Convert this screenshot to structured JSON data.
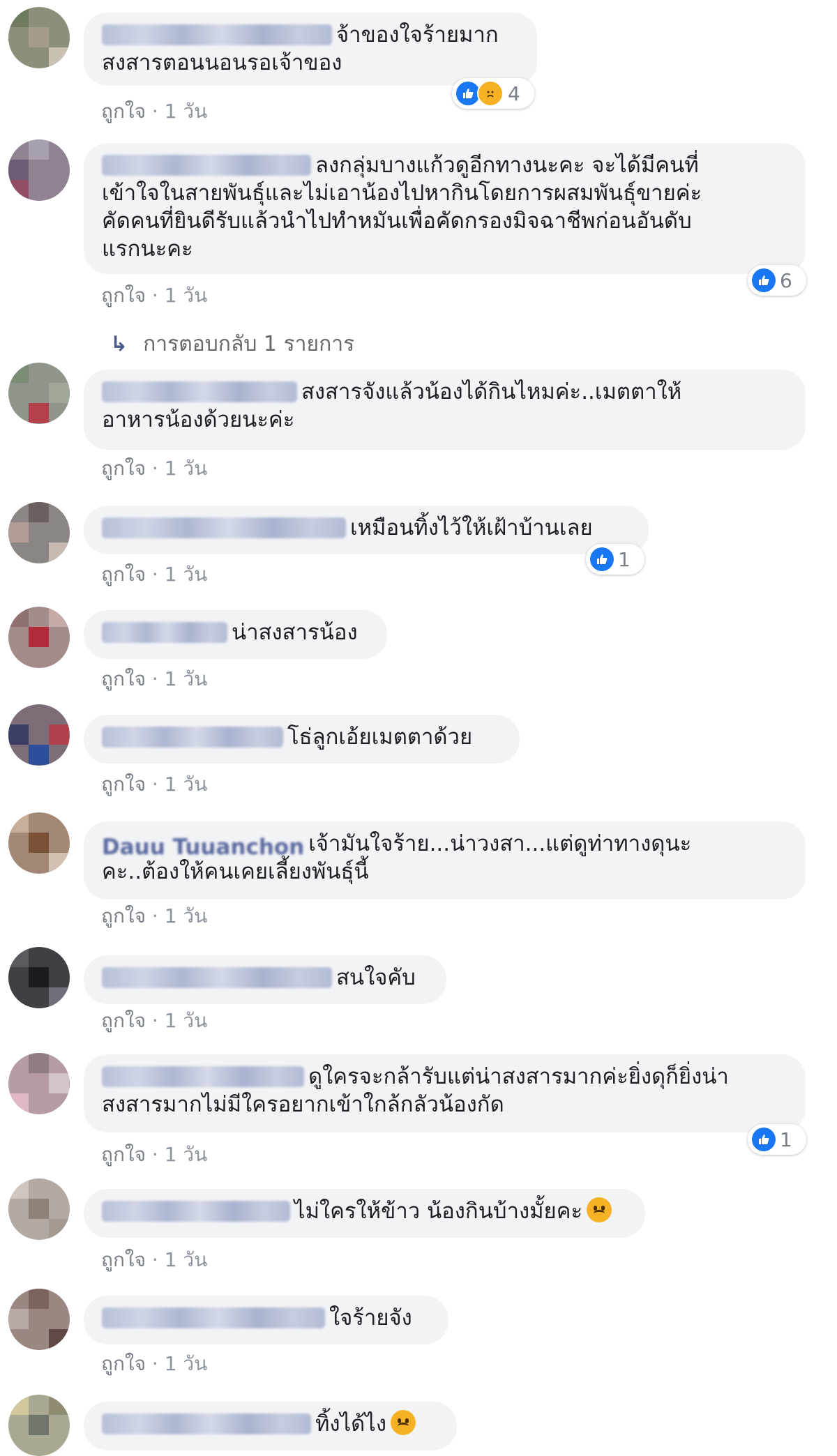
{
  "like_label": "ถูกใจ",
  "separator": "·",
  "time_label": "1 วัน",
  "replies_label": "การตอบกลับ 1 รายการ",
  "colors": {
    "bubble": "#f2f3f5",
    "like_blue": "#1877f2",
    "meta_gray": "#8d949e"
  },
  "comments": [
    {
      "text": "จ้าของใจร้ายมาก\nสงสารตอนนอนรอเจ้าของ",
      "reactions": {
        "count": "4",
        "types": [
          "like-icon",
          "sad-icon"
        ]
      }
    },
    {
      "text": "ลงกลุ่มบางแก้วดูอีกทางนะคะ จะได้มีคนที่\nเข้าใจในสายพันธุ์และไม่เอาน้องไปหากินโดยการผสมพันธุ์ขายค่ะ\nคัดคนที่ยินดีรับแล้วนำไปทำหมันเพื่อคัดกรองมิจฉาชีพก่อนอันดับ\nแรกนะคะ",
      "reactions": {
        "count": "6",
        "types": [
          "like-icon"
        ]
      }
    },
    {
      "text": "สงสารจังแล้วน้องได้กินไหมค่ะ..เมตตาให้\nอาหารน้องด้วยนะค่ะ"
    },
    {
      "text": "เหมือนทิ้งไว้ให้เฝ้าบ้านเลย",
      "reactions": {
        "count": "1",
        "types": [
          "like-icon"
        ]
      }
    },
    {
      "text": "น่าสงสารน้อง"
    },
    {
      "text": "โธ่ลูกเอ้ยเมตตาด้วย"
    },
    {
      "name": "Dauu Tuuanchon",
      "text": "เจ้ามันใจร้าย...น่าวงสา...แต่ดูท่าทางดุนะ\nคะ..ต้องให้คนเคยเลี้ยงพันธุ์นี้"
    },
    {
      "text": "สนใจคับ"
    },
    {
      "text": "ดูใครจะกล้ารับแต่น่าสงสารมากค่ะยิ่งดุก็ยิ่งน่า\nสงสารมากไม่มีใครอยากเข้าใกล้กลัวน้องกัด",
      "reactions": {
        "count": "1",
        "types": [
          "like-icon"
        ]
      }
    },
    {
      "text": "ไม่ใครให้ข้าว น้องกินบ้างมั้ยคะ",
      "emoji": "sad-face-emoji"
    },
    {
      "text": "ใจร้ายจัง"
    },
    {
      "text": "ทิ้งได้ไง",
      "emoji": "sad-face-emoji"
    }
  ]
}
